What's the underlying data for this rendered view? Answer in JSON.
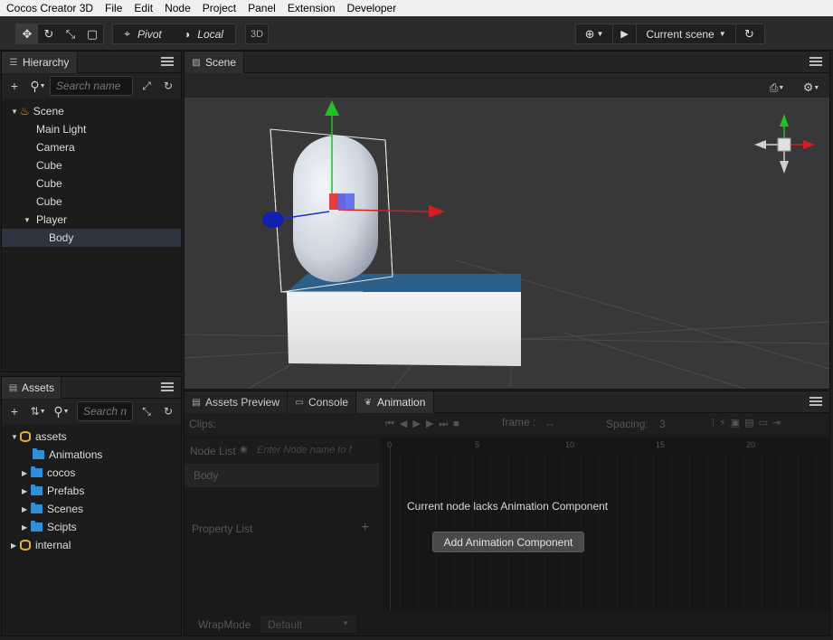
{
  "menu": [
    "Cocos Creator 3D",
    "File",
    "Edit",
    "Node",
    "Project",
    "Panel",
    "Extension",
    "Developer"
  ],
  "toolbar": {
    "pivot_label": "Pivot",
    "local_label": "Local",
    "mode_3d": "3D",
    "current_scene": "Current scene"
  },
  "hierarchy": {
    "tab": "Hierarchy",
    "search_placeholder": "Search name",
    "items": [
      {
        "label": "Scene",
        "depth": 0
      },
      {
        "label": "Main Light",
        "depth": 1
      },
      {
        "label": "Camera",
        "depth": 1
      },
      {
        "label": "Cube",
        "depth": 1
      },
      {
        "label": "Cube",
        "depth": 1
      },
      {
        "label": "Cube",
        "depth": 1
      },
      {
        "label": "Player",
        "depth": 1
      },
      {
        "label": "Body",
        "depth": 2
      }
    ]
  },
  "assets": {
    "tab": "Assets",
    "search_placeholder": "Search n",
    "items": [
      {
        "label": "assets",
        "depth": 0
      },
      {
        "label": "Animations",
        "depth": 1
      },
      {
        "label": "cocos",
        "depth": 1
      },
      {
        "label": "Prefabs",
        "depth": 1
      },
      {
        "label": "Scenes",
        "depth": 1
      },
      {
        "label": "Scipts",
        "depth": 1
      },
      {
        "label": "internal",
        "depth": 0
      }
    ]
  },
  "scene": {
    "tab": "Scene"
  },
  "bottom_tabs": [
    "Assets Preview",
    "Console",
    "Animation"
  ],
  "animation": {
    "clips_label": "Clips:",
    "frame_label": "frame :",
    "frame_value": "--",
    "spacing_label": "Spacing:",
    "spacing_value": "3",
    "node_list_label": "Node List",
    "node_filter_placeholder": "Enter Node name to f",
    "node_name": "Body",
    "property_list_label": "Property List",
    "timeline_ticks": [
      "0",
      "5",
      "10",
      "15",
      "20"
    ],
    "message": "Current node lacks Animation Component",
    "add_button": "Add Animation Component",
    "wrapmode_label": "WrapMode",
    "wrapmode_value": "Default"
  },
  "colors": {
    "accent": "#2f8fd8",
    "timeline_cursor": "#d03020"
  }
}
